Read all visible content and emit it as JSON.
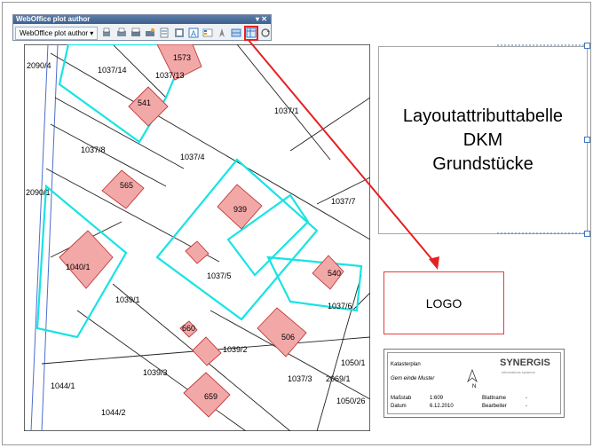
{
  "toolbar": {
    "title": "WebOffice plot author",
    "window_controls": "▾ ✕",
    "dropdown_label": "WebOffice plot author ▾",
    "buttons": [
      {
        "name": "print-portrait-icon"
      },
      {
        "name": "print-landscape-icon"
      },
      {
        "name": "print-a3-icon"
      },
      {
        "name": "print-a4-icon"
      },
      {
        "name": "print-settings-icon"
      },
      {
        "name": "print-preview-icon"
      },
      {
        "name": "text-element-icon"
      },
      {
        "name": "legend-element-icon"
      },
      {
        "name": "north-arrow-icon"
      },
      {
        "name": "scalebar-icon"
      },
      {
        "name": "attribute-table-icon"
      },
      {
        "name": "refresh-icon"
      }
    ],
    "highlighted_button": "attribute-table-icon"
  },
  "map": {
    "parcel_labels": [
      "2090/4",
      "1037/14",
      "1037/13",
      "1573",
      "541",
      "1037/1",
      "1037/8",
      "1037/4",
      "565",
      "2090/1",
      "939",
      "1037/7",
      "1040/1",
      "1037/5",
      "540",
      "1039/1",
      "1037/6",
      "660",
      "1039/2",
      "506",
      "1039/3",
      "1050/1",
      "1044/1",
      "1037/3",
      "2069/1",
      "659",
      "1044/2",
      "1050/26"
    ],
    "parcel_color": "#f3a8a8",
    "parcel_outline": "#c03a3a",
    "highlight_color": "#19e3e3"
  },
  "attribute_box": {
    "lines": [
      "Layoutattributtabelle",
      "DKM",
      "Grundstücke"
    ]
  },
  "logo_box": {
    "label": "LOGO"
  },
  "legend": {
    "title": "Katasterplan",
    "municipality": "Gem einde Muster",
    "brand": "SYNERGIS",
    "brand_tagline": "informations systeme",
    "north": "N",
    "rows": [
      {
        "k": "Maßstab",
        "v": "1:609",
        "k2": "Blattname",
        "v2": "-"
      },
      {
        "k": "Datum",
        "v": "6.12.2010",
        "k2": "Bearbeiter",
        "v2": "-"
      }
    ]
  },
  "colors": {
    "arrow": "#e62020",
    "accent": "#3b78c2"
  }
}
